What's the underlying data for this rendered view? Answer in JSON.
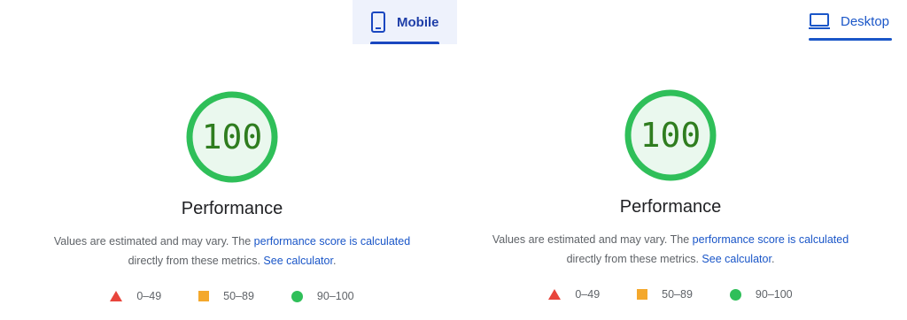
{
  "tabs": {
    "mobile": {
      "label": "Mobile",
      "icon": "phone-icon",
      "active": true
    },
    "desktop": {
      "label": "Desktop",
      "icon": "laptop-icon",
      "active": false
    }
  },
  "panels": [
    {
      "score": "100",
      "title": "Performance",
      "desc_text": "Values are estimated and may vary. The",
      "desc_link1": "performance score is calculated",
      "desc_middle": "directly from these metrics.",
      "desc_link2": "See calculator",
      "desc_end": "."
    },
    {
      "score": "100",
      "title": "Performance",
      "desc_text": "Values are estimated and may vary. The",
      "desc_link1": "performance score is calculated",
      "desc_middle": "directly from these metrics.",
      "desc_link2": "See calculator",
      "desc_end": "."
    }
  ],
  "legend": {
    "fail": "0–49",
    "average": "50–89",
    "pass": "90–100"
  },
  "colors": {
    "pass": "#2fbf59",
    "average": "#f4a82c",
    "fail": "#e8453c",
    "accent": "#1a56c8"
  }
}
